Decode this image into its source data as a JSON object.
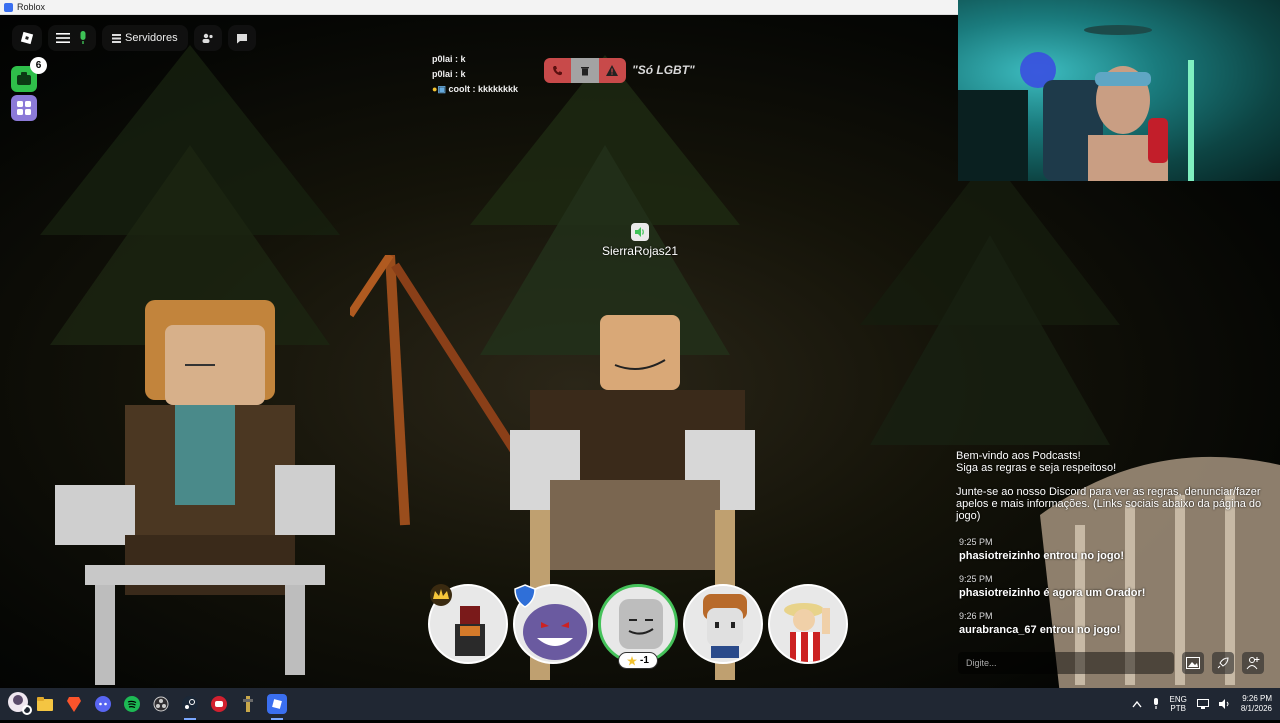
{
  "window": {
    "title": "Roblox"
  },
  "topbar": {
    "servers_label": "Servidores",
    "notification_count": "6"
  },
  "top_chat": [
    {
      "user": "p0lai",
      "text": "k"
    },
    {
      "user": "p0lai",
      "text": "k"
    },
    {
      "user": "coolt",
      "text": "kkkkkkkk"
    }
  ],
  "room_title": "\"Só LGBT\"",
  "speaker": {
    "name": "SierraRojas21"
  },
  "info": {
    "welcome": "Bem-vindo aos Podcasts!",
    "rules": "Siga as regras e seja respeitoso!",
    "discord": "Junte-se ao nosso Discord para ver as regras, denunciar/fazer apelos e mais informações. (Links sociais abaixo da página do jogo)"
  },
  "chat_log": [
    {
      "time": "9:25 PM",
      "message": "phasiotreizinho entrou no jogo!"
    },
    {
      "time": "9:25 PM",
      "message": "phasiotreizinho é agora um Orador!"
    },
    {
      "time": "9:26 PM",
      "message": "aurabranca_67 entrou no jogo!"
    }
  ],
  "chat_input": {
    "placeholder": "Digite..."
  },
  "avatars": [
    {
      "id": "avatar-1",
      "badge": "crown"
    },
    {
      "id": "avatar-2",
      "badge": "shield"
    },
    {
      "id": "avatar-3",
      "speaking": true,
      "star_count": "-1"
    },
    {
      "id": "avatar-4"
    },
    {
      "id": "avatar-5"
    }
  ],
  "taskbar": {
    "lang_top": "ENG",
    "lang_bottom": "PTB",
    "time": "9:26 PM",
    "date": "8/1/2026"
  },
  "colors": {
    "speaking_ring": "#45c25a",
    "call_bar": "#c84a4a",
    "taskbar": "#202733"
  }
}
